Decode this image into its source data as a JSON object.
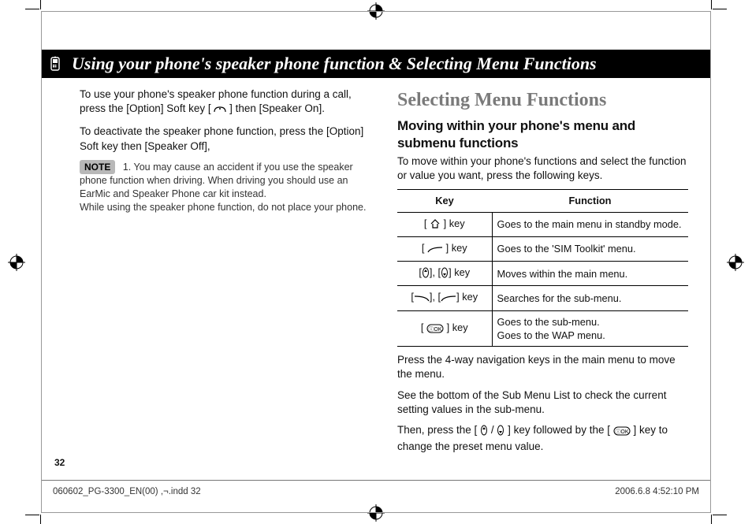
{
  "header": {
    "title": "Using your phone's speaker phone function & Selecting Menu Functions"
  },
  "left": {
    "p1a": "To use your phone's speaker phone function during a call, press the [Option] Soft key [",
    "p1b": "] then [Speaker On].",
    "p2": "To deactivate the speaker phone function, press the [Option] Soft key then [Speaker Off],",
    "note_label": "NOTE",
    "note_line1": "1. You may cause an accident if you use the speaker",
    "note_rest": "phone function when driving. When driving you should use an EarMic and Speaker Phone car kit instead.\nWhile using the speaker phone function, do not place your phone."
  },
  "right": {
    "section_title": "Selecting Menu Functions",
    "subsection_title": "Moving within your phone's menu and submenu functions",
    "intro": "To move within your phone's functions and select the function or value you want, press the following keys.",
    "table": {
      "head_key": "Key",
      "head_func": "Function",
      "rows": [
        {
          "key_prefix": "[",
          "key_glyph": "home-icon",
          "key_suffix": "] key",
          "func": "Goes to the main menu in standby mode."
        },
        {
          "key_prefix": "[",
          "key_glyph": "softkey-right-icon",
          "key_suffix": "] key",
          "func": "Goes to the 'SIM Toolkit' menu."
        },
        {
          "key_text": "[ ▯ ], [ ▯ ] key",
          "key_glyph_pair": "updown-icons",
          "func": "Moves within the main menu."
        },
        {
          "key_text": "[ ⟵ ], [ ⟶ ] key",
          "key_glyph_pair": "softkey-both-icons",
          "func": "Searches for the sub-menu."
        },
        {
          "key_prefix": "[",
          "key_glyph": "ok-icon",
          "key_suffix": "] key",
          "func": "Goes to the sub-menu.\nGoes to the WAP menu."
        }
      ]
    },
    "after1": "Press the 4-way navigation keys in the main menu to move the menu.",
    "after2": "See the bottom of the Sub Menu List to check the current setting values in the sub-menu.",
    "after3a": "Then, press the [",
    "after3b": "/",
    "after3c": "] key followed by the [",
    "after3d": "] key to change the preset menu value."
  },
  "page_number": "32",
  "footer": {
    "left": "060602_PG-3300_EN(00) ,¬.indd   32",
    "right": "2006.6.8   4:52:10 PM"
  }
}
